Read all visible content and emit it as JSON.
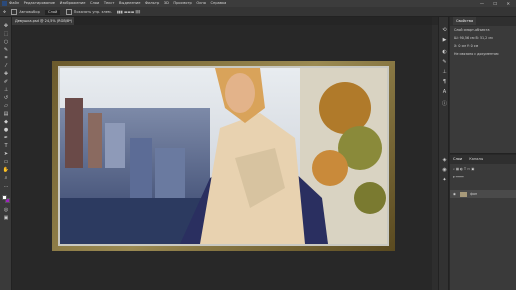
{
  "menubar": {
    "items": [
      "Файл",
      "Редактирование",
      "Изображение",
      "Слои",
      "Текст",
      "Выделение",
      "Фильтр",
      "3D",
      "Просмотр",
      "Окно",
      "Справка"
    ],
    "window_controls": "—  ☐  ✕"
  },
  "options_bar": {
    "auto_select_label": "Автовыбор",
    "layer_value": "Слой",
    "transform_label": "Показать упр. элем."
  },
  "document_tab": {
    "title": "Девушка.psd @ 24,5% (RGB/8*) ×"
  },
  "panels": {
    "top_tabs": [
      "Свойства"
    ],
    "top_rows": [
      "Слой смарт-объекта",
      "Ш: 90,56 см   В: 51,2 см",
      "X: 0 см   Y: 0 см",
      "Не связано с документом"
    ],
    "bottom_tabs": [
      "Слои",
      "Каналы"
    ],
    "layer_name": "фон"
  },
  "colors": {
    "background": "#282828",
    "foreground_swatch": "#ffffff",
    "background_swatch": "#a020c0",
    "frame_gold": "#9b8a52"
  }
}
